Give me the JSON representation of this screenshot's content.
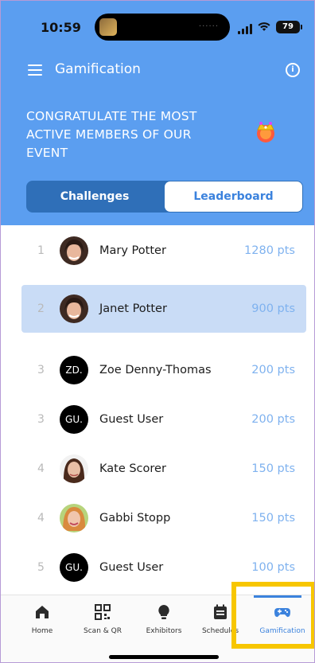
{
  "status": {
    "time": "10:59",
    "battery": "79"
  },
  "header": {
    "title": "Gamification",
    "banner": "CONGRATULATE THE MOST ACTIVE MEMBERS OF OUR EVENT"
  },
  "tabs": {
    "challenges": "Challenges",
    "leaderboard": "Leaderboard",
    "active": "Leaderboard"
  },
  "leaderboard": [
    {
      "rank": "1",
      "name": "Mary Potter",
      "points": "1280 pts",
      "avatar": "photo",
      "highlighted": false
    },
    {
      "rank": "2",
      "name": "Janet Potter",
      "points": "900 pts",
      "avatar": "photo",
      "highlighted": true
    },
    {
      "rank": "3",
      "name": "Zoe Denny-Thomas",
      "points": "200 pts",
      "avatar": "ZD."
    },
    {
      "rank": "3",
      "name": "Guest User",
      "points": "200 pts",
      "avatar": "GU."
    },
    {
      "rank": "4",
      "name": "Kate Scorer",
      "points": "150 pts",
      "avatar": "photo"
    },
    {
      "rank": "4",
      "name": "Gabbi Stopp",
      "points": "150 pts",
      "avatar": "photo"
    },
    {
      "rank": "5",
      "name": "Guest User",
      "points": "100 pts",
      "avatar": "GU."
    }
  ],
  "nav": {
    "home": "Home",
    "scan": "Scan & QR",
    "exhibitors": "Exhibitors",
    "schedule": "Schedules",
    "gamification": "Gamification",
    "active": "Gamification"
  },
  "colors": {
    "header_blue": "#5b9ef0",
    "segment_dark": "#2f6fb8",
    "accent": "#3b82dd",
    "highlight_row": "#c9dcf6",
    "points_text": "#7fb2ef",
    "focus_box": "#f7c600"
  }
}
